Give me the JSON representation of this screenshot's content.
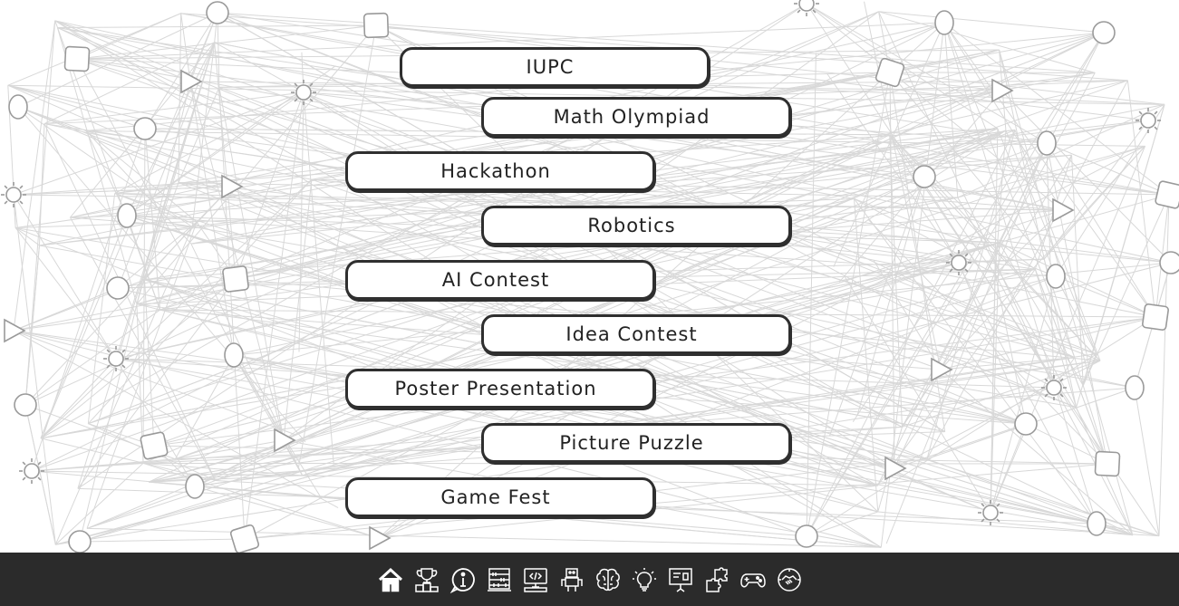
{
  "events": [
    {
      "label": "IUPC",
      "side": "left"
    },
    {
      "label": "Math Olympiad",
      "side": "right"
    },
    {
      "label": "Hackathon",
      "side": "left"
    },
    {
      "label": "Robotics",
      "side": "right"
    },
    {
      "label": "AI Contest",
      "side": "left"
    },
    {
      "label": "Idea Contest",
      "side": "right"
    },
    {
      "label": "Poster Presentation",
      "side": "left"
    },
    {
      "label": "Picture Puzzle",
      "side": "right"
    },
    {
      "label": "Game Fest",
      "side": "left"
    }
  ],
  "nav_icons": [
    "home-icon",
    "trophy-podium-icon",
    "info-icon",
    "abacus-icon",
    "code-monitor-icon",
    "robot-icon",
    "brain-icon",
    "lightbulb-icon",
    "presentation-icon",
    "puzzle-icon",
    "gamepad-icon",
    "handshake-icon"
  ],
  "colors": {
    "bar": "#2b2b2b",
    "button_border": "#2f2f2f",
    "icon": "#ffffff",
    "lines": "#d4d4d4"
  }
}
